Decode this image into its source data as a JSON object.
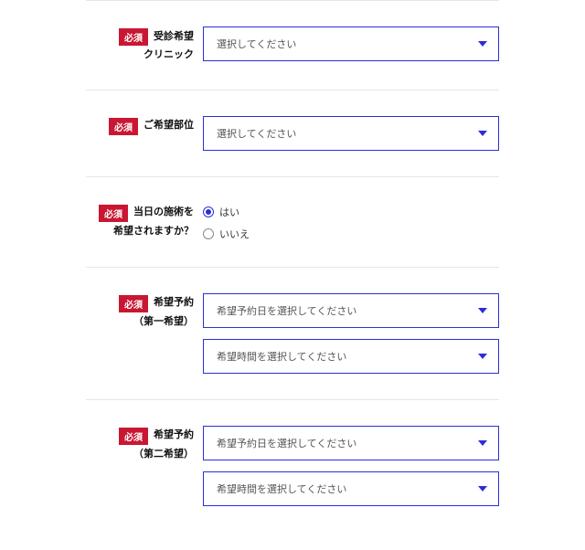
{
  "required_label": "必須",
  "fields": {
    "clinic": {
      "label_line1": "受診希望",
      "label_line2": "クリニック",
      "placeholder": "選択してください"
    },
    "part": {
      "label": "ご希望部位",
      "placeholder": "選択してください"
    },
    "sameday": {
      "label_line1": "当日の施術を",
      "label_line2": "希望されますか？",
      "option_yes": "はい",
      "option_no": "いいえ",
      "selected": "yes"
    },
    "pref1": {
      "label_line1": "希望予約",
      "label_line2": "（第一希望）",
      "date_placeholder": "希望予約日を選択してください",
      "time_placeholder": "希望時間を選択してください"
    },
    "pref2": {
      "label_line1": "希望予約",
      "label_line2": "（第二希望）",
      "date_placeholder": "希望予約日を選択してください",
      "time_placeholder": "希望時間を選択してください"
    }
  }
}
